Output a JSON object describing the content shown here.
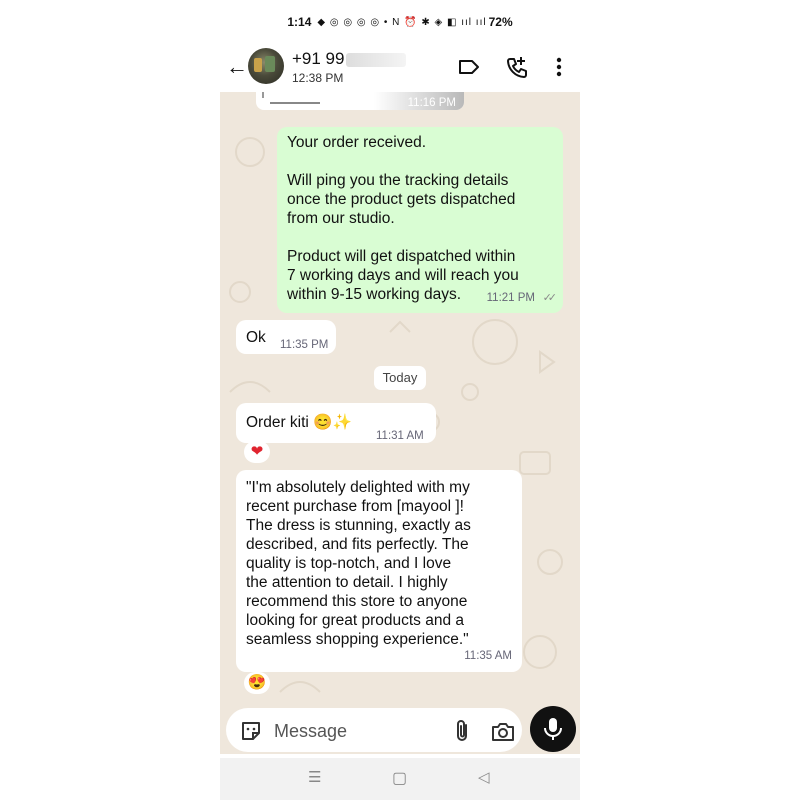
{
  "status_bar": {
    "time": "1:14",
    "indicators": "◆ ◎ ◎ ◎ ◎ •  N ⏰ ✱ ◈ ◧ ııl ııl",
    "battery": "72%"
  },
  "header": {
    "contact_name_visible": "+91 99",
    "last_seen": "12:38 PM",
    "icons": [
      "back-arrow-icon",
      "label-icon",
      "add-call-icon",
      "more-vert-icon"
    ]
  },
  "chat": {
    "previous_message_time": "11:16 PM",
    "messages": [
      {
        "direction": "outgoing",
        "lines": [
          "Your order received.",
          "",
          "Will ping you the tracking details",
          "once the product gets dispatched",
          "from our studio.",
          "",
          "Product will get dispatched within",
          "7 working days and will reach you",
          "within 9-15 working days."
        ],
        "time": "11:21 PM",
        "status": "✓✓"
      },
      {
        "direction": "incoming",
        "text": "Ok",
        "time": "11:35 PM"
      },
      {
        "direction": "incoming",
        "text": "Order kiti 😊✨",
        "time": "11:31 AM",
        "reaction": "❤"
      },
      {
        "direction": "incoming",
        "lines": [
          "\"I'm absolutely delighted with my",
          "recent purchase from [mayool ]!",
          "The dress is stunning, exactly as",
          "described, and fits perfectly. The",
          "quality is top-notch, and I love",
          "the attention to detail. I highly",
          "recommend this store to anyone",
          "looking for great products and a",
          "seamless shopping experience.\""
        ],
        "time": "11:35 AM",
        "reaction": "😍"
      }
    ],
    "date_chip": "Today"
  },
  "input": {
    "placeholder": "Message",
    "icons": [
      "sticker-icon",
      "attach-icon",
      "camera-icon",
      "mic-icon"
    ]
  },
  "nav_bar": {
    "recents": "☰",
    "home": "▢",
    "back": "◁"
  },
  "colors": {
    "chat_bg": "#efe7dc",
    "outgoing_bubble": "#d9fdd3",
    "incoming_bubble": "#ffffff",
    "mic_button": "#111111"
  }
}
